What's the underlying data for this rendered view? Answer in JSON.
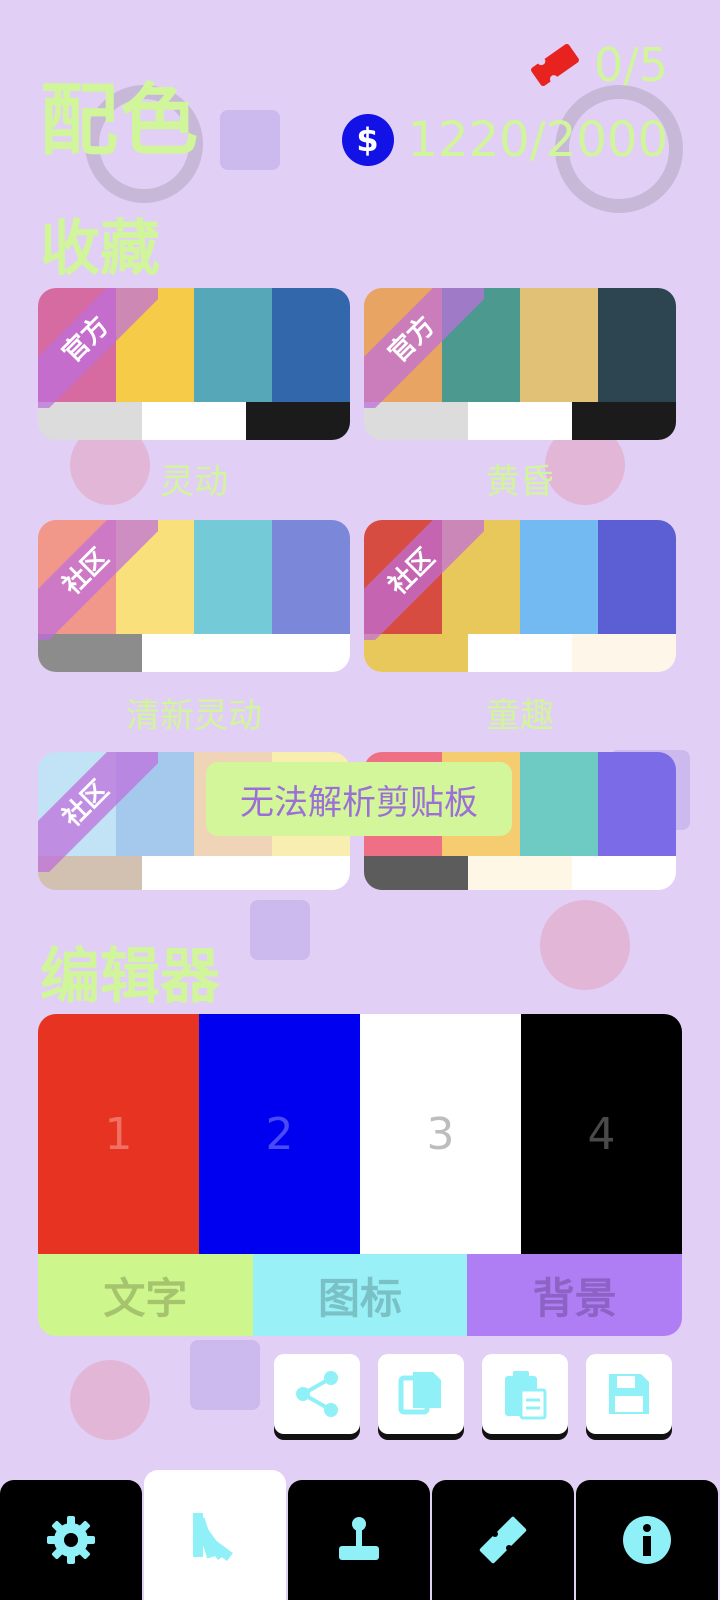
{
  "header": {
    "title": "配色",
    "tickets": "0/5",
    "coin_symbol": "$",
    "coins": "1220/2000"
  },
  "favorites": {
    "title": "收藏",
    "palettes": [
      {
        "name": "灵动",
        "tag": "官方",
        "top": [
          "#d66ba2",
          "#f5cb48",
          "#56a8b8",
          "#3267ab"
        ],
        "bottom": [
          "#dcdcdc",
          "#ffffff",
          "#1b1b1b"
        ]
      },
      {
        "name": "黄昏",
        "tag": "官方",
        "top": [
          "#e8a463",
          "#4c9a8f",
          "#e0c176",
          "#2d4550"
        ],
        "bottom": [
          "#dcdcdc",
          "#ffffff",
          "#1b1b1b"
        ]
      },
      {
        "name": "清新灵动",
        "tag": "社区",
        "top": [
          "#f2988b",
          "#fae07a",
          "#74cad6",
          "#7b88d9"
        ],
        "bottom": [
          "#8c8c8c",
          "#ffffff",
          "#ffffff"
        ]
      },
      {
        "name": "童趣",
        "tag": "社区",
        "top": [
          "#d64c40",
          "#e8c85a",
          "#74baf2",
          "#5b5fd3"
        ],
        "bottom": [
          "#e8c85a",
          "#ffffff",
          "#fff6ea"
        ]
      },
      {
        "name": "",
        "tag": "社区",
        "top": [
          "#c2e2f5",
          "#a5c9ec",
          "#f0d4b8",
          "#f7eeb0"
        ],
        "bottom": [
          "#d2c1b0",
          "#ffffff",
          "#ffffff"
        ]
      },
      {
        "name": "",
        "tag": "",
        "top": [
          "#ef6f84",
          "#f5cc70",
          "#6ecbc4",
          "#7b6be6"
        ],
        "bottom": [
          "#5c5c5c",
          "#fff7e6",
          "#ffffff"
        ]
      }
    ]
  },
  "toast": "无法解析剪贴板",
  "editor": {
    "title": "编辑器",
    "swatches": [
      {
        "label": "1",
        "color": "#e63322",
        "text_color": "#f07063"
      },
      {
        "label": "2",
        "color": "#0000f0",
        "text_color": "#4a4af7"
      },
      {
        "label": "3",
        "color": "#ffffff",
        "text_color": "#bdbdbd"
      },
      {
        "label": "4",
        "color": "#000000",
        "text_color": "#4a4a4a"
      }
    ],
    "tabs": [
      {
        "label": "文字",
        "color": "#cdf68d",
        "text_color": "#a6c46e"
      },
      {
        "label": "图标",
        "color": "#9af0f7",
        "text_color": "#7ac1c6"
      },
      {
        "label": "背景",
        "color": "#b07ef4",
        "text_color": "#8c63c5"
      }
    ]
  },
  "actions": [
    "share-icon",
    "copy-icon",
    "paste-icon",
    "save-icon"
  ],
  "nav": [
    "settings",
    "palette",
    "games",
    "tickets",
    "info"
  ],
  "accent": "#8ff0f7"
}
